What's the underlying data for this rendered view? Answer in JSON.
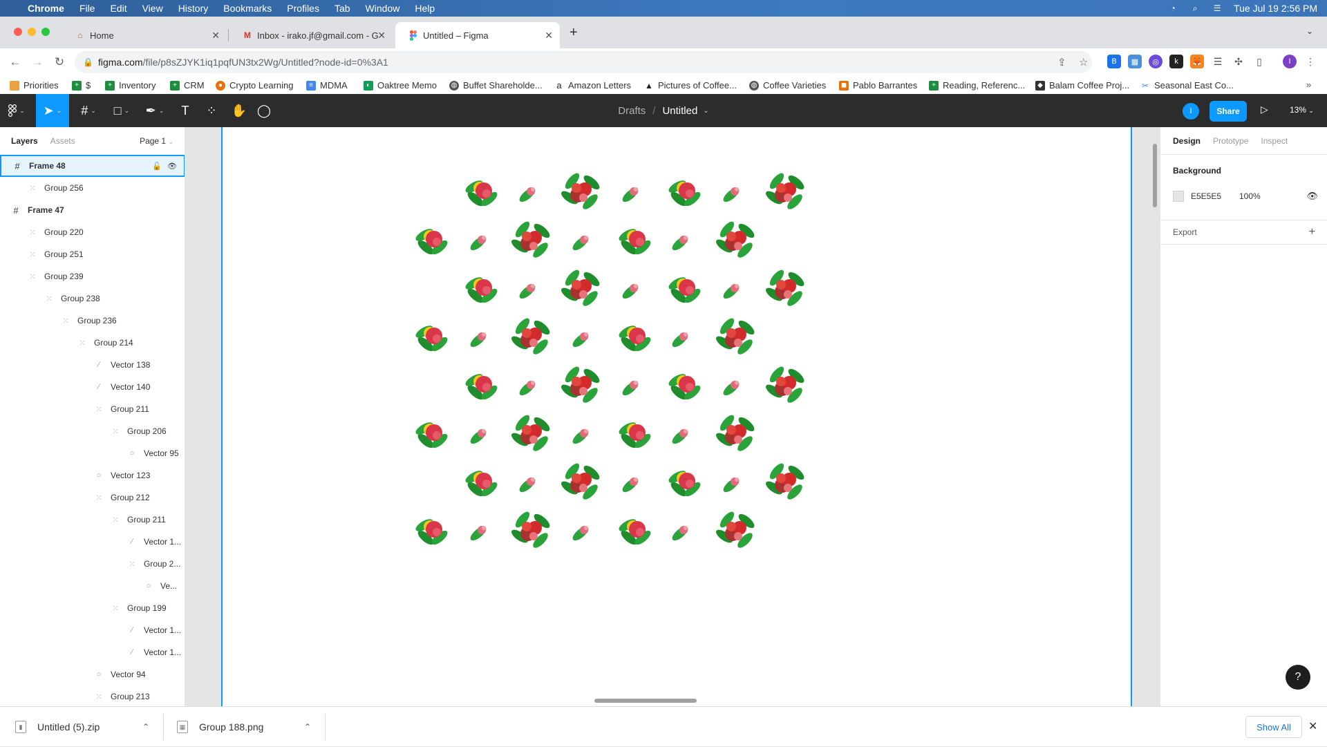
{
  "menubar": {
    "app": "Chrome",
    "items": [
      "File",
      "Edit",
      "View",
      "History",
      "Bookmarks",
      "Profiles",
      "Tab",
      "Window",
      "Help"
    ],
    "datetime": "Tue Jul 19  2:56 PM"
  },
  "tabs": [
    {
      "title": "Home",
      "icon": "home-favicon"
    },
    {
      "title": "Inbox - irako.jf@gmail.com - G",
      "icon": "gmail-favicon"
    },
    {
      "title": "Untitled – Figma",
      "icon": "figma-favicon",
      "active": true
    }
  ],
  "address": {
    "host": "figma.com",
    "path": "/file/p8sZJYK1iq1pqfUN3tx2Wg/Untitled?node-id=0%3A1"
  },
  "bookmarks": [
    {
      "label": "Priorities",
      "color": "#e8a33d"
    },
    {
      "label": "$",
      "color": "#1e8e3e"
    },
    {
      "label": "Inventory",
      "color": "#1e8e3e"
    },
    {
      "label": "CRM",
      "color": "#1e8e3e"
    },
    {
      "label": "Crypto Learning",
      "color": "#e8710a"
    },
    {
      "label": "MDMA",
      "color": "#4285f4"
    },
    {
      "label": "Oaktree Memo",
      "color": "#0f9d58"
    },
    {
      "label": "Buffet Shareholde...",
      "color": "#555555"
    },
    {
      "label": "Amazon Letters",
      "color": "#222222"
    },
    {
      "label": "Pictures of Coffee...",
      "color": "#222222"
    },
    {
      "label": "Coffee Varieties",
      "color": "#555555"
    },
    {
      "label": "Pablo Barrantes",
      "color": "#e8710a"
    },
    {
      "label": "Reading, Referenc...",
      "color": "#1e8e3e"
    },
    {
      "label": "Balam Coffee Proj...",
      "color": "#333333"
    },
    {
      "label": "Seasonal East Co...",
      "color": "#4285f4"
    }
  ],
  "figma": {
    "breadcrumb_parent": "Drafts",
    "file_name": "Untitled",
    "avatar_initial": "I",
    "share_label": "Share",
    "zoom": "13%",
    "left_tabs": {
      "layers": "Layers",
      "assets": "Assets"
    },
    "page": "Page 1",
    "layers": [
      {
        "name": "Frame 48",
        "type": "frame",
        "depth": 0,
        "selected": true
      },
      {
        "name": "Group 256",
        "type": "group",
        "depth": 1
      },
      {
        "name": "Frame 47",
        "type": "frame",
        "depth": 0
      },
      {
        "name": "Group 220",
        "type": "group",
        "depth": 1
      },
      {
        "name": "Group 251",
        "type": "group",
        "depth": 1
      },
      {
        "name": "Group 239",
        "type": "group",
        "depth": 1
      },
      {
        "name": "Group 238",
        "type": "group",
        "depth": 2
      },
      {
        "name": "Group 236",
        "type": "group",
        "depth": 3
      },
      {
        "name": "Group 214",
        "type": "group",
        "depth": 4
      },
      {
        "name": "Vector 138",
        "type": "vector",
        "depth": 5
      },
      {
        "name": "Vector 140",
        "type": "vector",
        "depth": 5
      },
      {
        "name": "Group 211",
        "type": "group",
        "depth": 5
      },
      {
        "name": "Group 206",
        "type": "group",
        "depth": 6
      },
      {
        "name": "Vector 95",
        "type": "ellipse",
        "depth": 7
      },
      {
        "name": "Vector 123",
        "type": "ellipse",
        "depth": 5
      },
      {
        "name": "Group 212",
        "type": "group",
        "depth": 5
      },
      {
        "name": "Group 211",
        "type": "group",
        "depth": 6
      },
      {
        "name": "Vector 1...",
        "type": "vector",
        "depth": 7
      },
      {
        "name": "Group 2...",
        "type": "group",
        "depth": 7
      },
      {
        "name": "Ve...",
        "type": "ellipse",
        "depth": 8
      },
      {
        "name": "Group 199",
        "type": "group",
        "depth": 6
      },
      {
        "name": "Vector 1...",
        "type": "vector",
        "depth": 7
      },
      {
        "name": "Vector 1...",
        "type": "vector",
        "depth": 7
      },
      {
        "name": "Vector 94",
        "type": "ellipse",
        "depth": 5
      },
      {
        "name": "Group 213",
        "type": "group",
        "depth": 5
      }
    ],
    "right_tabs": {
      "design": "Design",
      "prototype": "Prototype",
      "inspect": "Inspect"
    },
    "background": {
      "title": "Background",
      "hex": "E5E5E5",
      "opacity": "100%",
      "color": "#e5e5e5"
    },
    "export_label": "Export",
    "help": "?"
  },
  "downloads": [
    {
      "name": "Untitled (5).zip"
    },
    {
      "name": "Group 188.png"
    }
  ],
  "downloads_show_all": "Show All"
}
